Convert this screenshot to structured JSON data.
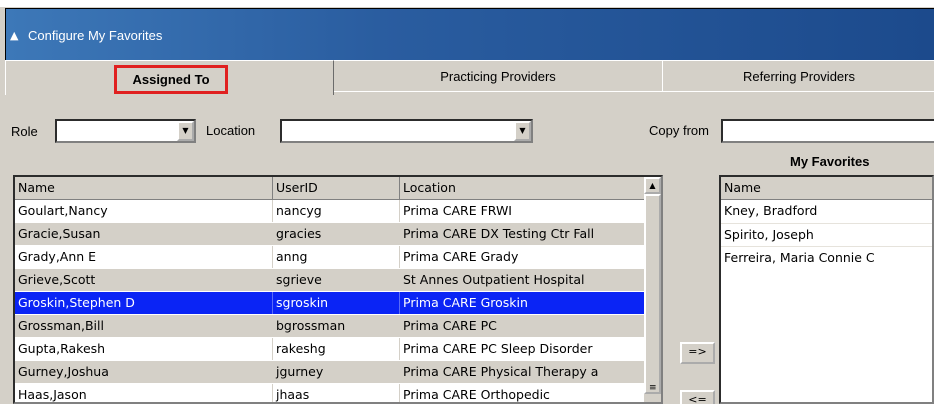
{
  "window": {
    "title": "Configure  My Favorites",
    "icon": "window-icon"
  },
  "tabs": [
    {
      "label": "Assigned To",
      "active": true
    },
    {
      "label": "Practicing Providers",
      "active": false
    },
    {
      "label": "Referring Providers",
      "active": false
    }
  ],
  "filters": {
    "role_label": "Role",
    "role_value": "",
    "location_label": "Location",
    "location_value": "",
    "copy_from_label": "Copy from",
    "copy_from_value": ""
  },
  "available": {
    "columns": [
      "Name",
      "UserID",
      "Location"
    ],
    "rows": [
      {
        "name": "Goulart,Nancy",
        "userid": "nancyg",
        "location": "Prima CARE FRWI"
      },
      {
        "name": "Gracie,Susan",
        "userid": "gracies",
        "location": "Prima CARE DX Testing Ctr Fall"
      },
      {
        "name": "Grady,Ann E",
        "userid": "anng",
        "location": "Prima CARE Grady"
      },
      {
        "name": "Grieve,Scott",
        "userid": "sgrieve",
        "location": "St Annes Outpatient Hospital"
      },
      {
        "name": "Groskin,Stephen D",
        "userid": "sgroskin",
        "location": "Prima CARE Groskin",
        "selected": true
      },
      {
        "name": "Grossman,Bill",
        "userid": "bgrossman",
        "location": "Prima CARE PC"
      },
      {
        "name": "Gupta,Rakesh",
        "userid": "rakeshg",
        "location": "Prima CARE PC Sleep Disorder"
      },
      {
        "name": "Gurney,Joshua",
        "userid": "jgurney",
        "location": "Prima CARE Physical Therapy a"
      },
      {
        "name": "Haas,Jason",
        "userid": "jhaas",
        "location": "Prima CARE Orthopedic"
      }
    ]
  },
  "buttons": {
    "add": "=>",
    "remove": "<="
  },
  "favorites": {
    "title": "My Favorites",
    "columns": [
      "Name"
    ],
    "rows": [
      "Kney, Bradford",
      "Spirito, Joseph",
      "Ferreira, Maria Connie C"
    ]
  },
  "colors": {
    "selection": "#0a24f5",
    "highlight_box": "#e02020",
    "title_bar": "#2a5da0"
  }
}
